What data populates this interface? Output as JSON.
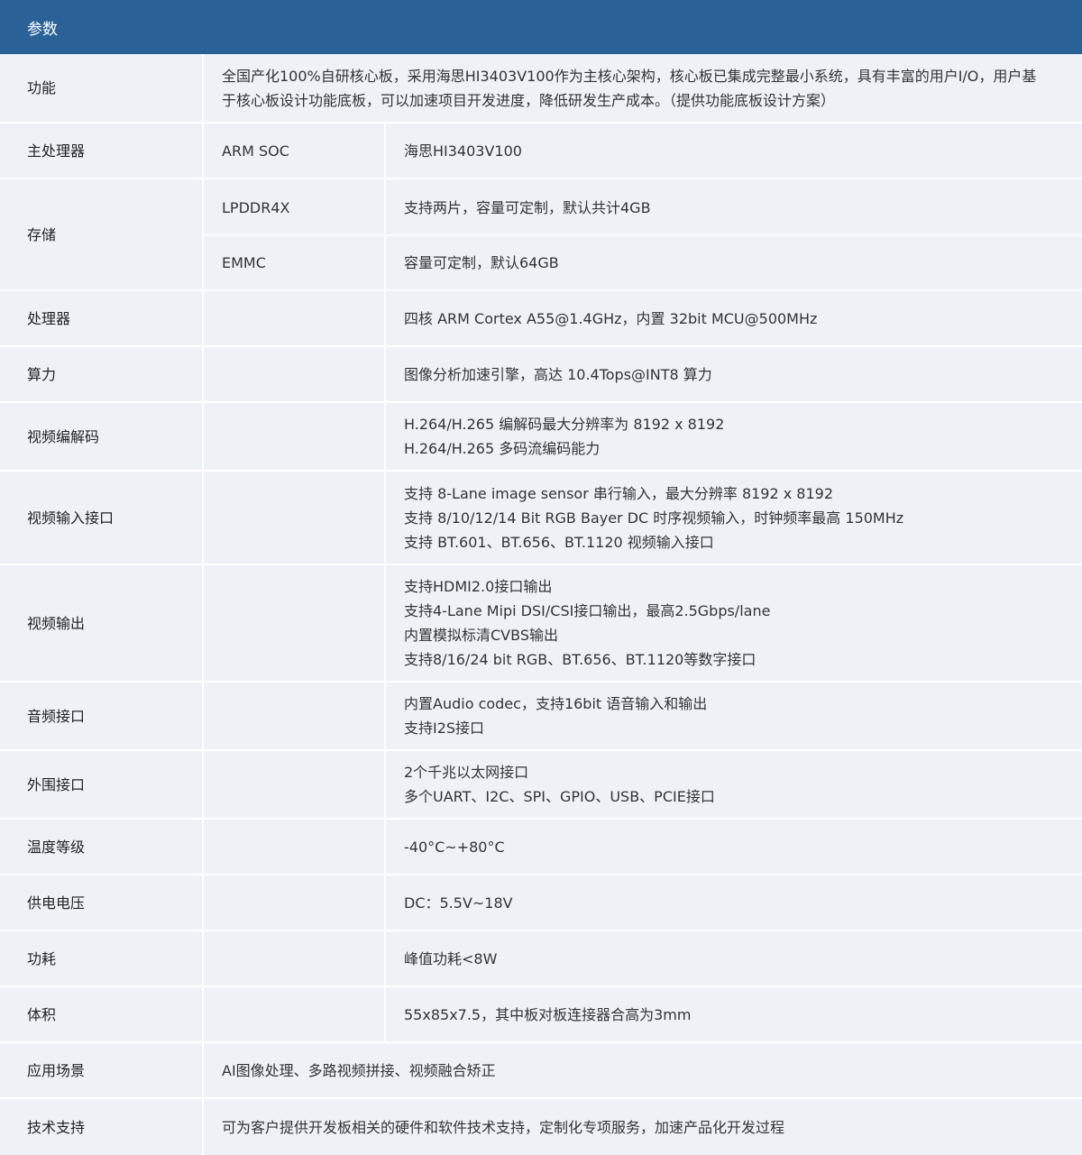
{
  "header": {
    "title": "参数"
  },
  "rows": {
    "function": {
      "label": "功能",
      "value": "全国产化100%自研核心板，采用海思HI3403V100作为主核心架构，核心板已集成完整最小系统，具有丰富的用户I/O，用户基于核心板设计功能底板，可以加速项目开发进度，降低研发生产成本。（提供功能底板设计方案）"
    },
    "main_processor": {
      "label": "主处理器",
      "sub": "ARM SOC",
      "value": "海思HI3403V100"
    },
    "storage": {
      "label": "存储",
      "items": [
        {
          "sub": "LPDDR4X",
          "value": "支持两片，容量可定制，默认共计4GB"
        },
        {
          "sub": "EMMC",
          "value": "容量可定制，默认64GB"
        }
      ]
    },
    "processor": {
      "label": "处理器",
      "value": "四核 ARM Cortex A55@1.4GHz，内置 32bit MCU@500MHz"
    },
    "compute": {
      "label": "算力",
      "value": "图像分析加速引擎，高达 10.4Tops@INT8 算力"
    },
    "video_codec": {
      "label": "视频编解码",
      "lines": [
        "H.264/H.265 编解码最大分辨率为 8192 x 8192",
        "H.264/H.265 多码流编码能力"
      ]
    },
    "video_input": {
      "label": "视频输入接口",
      "lines": [
        "支持 8-Lane image sensor 串行输入，最大分辨率 8192 x 8192",
        "支持 8/10/12/14 Bit RGB Bayer DC 时序视频输入，时钟频率最高 150MHz",
        "支持 BT.601、BT.656、BT.1120 视频输入接口"
      ]
    },
    "video_output": {
      "label": "视频输出",
      "lines": [
        "支持HDMI2.0接口输出",
        "支持4-Lane Mipi DSI/CSI接口输出，最高2.5Gbps/lane",
        "内置模拟标清CVBS输出",
        "支持8/16/24 bit RGB、BT.656、BT.1120等数字接口"
      ]
    },
    "audio": {
      "label": "音频接口",
      "lines": [
        "内置Audio codec，支持16bit 语音输入和输出",
        "支持I2S接口"
      ]
    },
    "peripheral": {
      "label": "外围接口",
      "lines": [
        "2个千兆以太网接口",
        "多个UART、I2C、SPI、GPIO、USB、PCIE接口"
      ]
    },
    "temperature": {
      "label": "温度等级",
      "value": "-40°C~+80°C"
    },
    "power_supply": {
      "label": "供电电压",
      "value": "DC：5.5V~18V"
    },
    "power_consumption": {
      "label": "功耗",
      "value": "峰值功耗<8W"
    },
    "volume": {
      "label": "体积",
      "value": "55x85x7.5，其中板对板连接器合高为3mm"
    },
    "application": {
      "label": "应用场景",
      "value": "AI图像处理、多路视频拼接、视频融合矫正"
    },
    "support": {
      "label": "技术支持",
      "value": "可为客户提供开发板相关的硬件和软件技术支持，定制化专项服务，加速产品化开发过程"
    }
  }
}
